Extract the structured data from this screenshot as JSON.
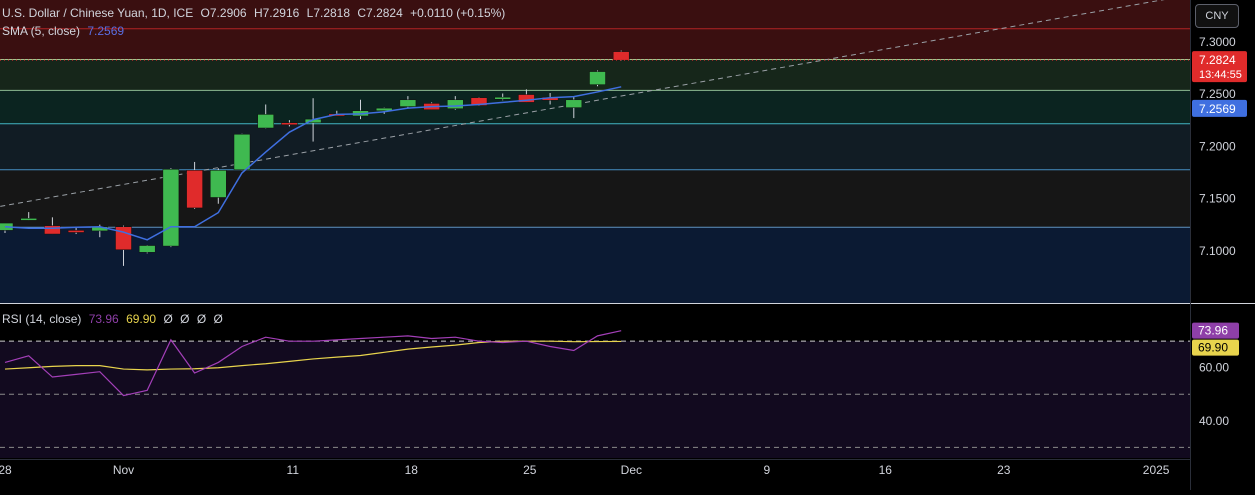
{
  "header": {
    "symbol": "U.S. Dollar / Chinese Yuan, 1D, ICE",
    "open": "O7.2906",
    "high": "H7.2916",
    "low": "L7.2818",
    "close": "C7.2824",
    "change": "+0.0110 (+0.15%)",
    "sma_label": "SMA (5, close)",
    "sma_value": "7.2569",
    "rsi_label": "RSI (14, close)",
    "rsi_value": "73.96",
    "rsi_ma_value": "69.90",
    "rsi_extra": [
      "Ø",
      "Ø",
      "Ø",
      "Ø"
    ]
  },
  "currency_button": "CNY",
  "colors": {
    "up": "#3fb950",
    "down": "#e02b2b",
    "sma": "#3f6fe0",
    "rsi": "#a33fb8",
    "rsi_ma": "#e8d44d",
    "price_tag": "#e02b2b",
    "sma_tag": "#3f6fe0"
  },
  "chart_data": [
    {
      "type": "candlestick",
      "title": "",
      "x_ticks": [
        "28",
        "Nov",
        "11",
        "18",
        "25",
        "Dec",
        "9",
        "16",
        "23",
        "2025"
      ],
      "y_ticks": [
        "7.3000",
        "7.2500",
        "7.2000",
        "7.1500",
        "7.1000"
      ],
      "ylim": [
        7.05,
        7.34
      ],
      "price_label": "7.2824",
      "countdown_label": "13:44:55",
      "sma_label": "7.2569",
      "bands": [
        {
          "from": 7.283,
          "to": 7.34,
          "color": "#3a0f10"
        },
        {
          "from": 7.2535,
          "to": 7.283,
          "color": "#16261a"
        },
        {
          "from": 7.2215,
          "to": 7.2535,
          "color": "#0b2420"
        },
        {
          "from": 7.1775,
          "to": 7.2215,
          "color": "#111c24"
        },
        {
          "from": 7.1225,
          "to": 7.1775,
          "color": "#161616"
        },
        {
          "from": 7.05,
          "to": 7.1225,
          "color": "#0b1a33"
        }
      ],
      "band_lines": [
        {
          "value": 7.3125,
          "color": "#c62828"
        },
        {
          "value": 7.283,
          "color": "#b6e3a3"
        },
        {
          "value": 7.2535,
          "color": "#a5d6a7"
        },
        {
          "value": 7.2215,
          "color": "#4dd0e1"
        },
        {
          "value": 7.1775,
          "color": "#4fa3e0"
        },
        {
          "value": 7.1225,
          "color": "#6fa8dc"
        }
      ],
      "candles": [
        {
          "o": 7.1195,
          "h": 7.1235,
          "l": 7.117,
          "c": 7.1265
        },
        {
          "o": 7.131,
          "h": 7.137,
          "l": 7.129,
          "c": 7.131
        },
        {
          "o": 7.124,
          "h": 7.132,
          "l": 7.116,
          "c": 7.116
        },
        {
          "o": 7.1195,
          "h": 7.122,
          "l": 7.116,
          "c": 7.1175
        },
        {
          "o": 7.119,
          "h": 7.125,
          "l": 7.113,
          "c": 7.123
        },
        {
          "o": 7.123,
          "h": 7.124,
          "l": 7.0855,
          "c": 7.101
        },
        {
          "o": 7.0985,
          "h": 7.1055,
          "l": 7.0975,
          "c": 7.105
        },
        {
          "o": 7.1045,
          "h": 7.179,
          "l": 7.1035,
          "c": 7.178
        },
        {
          "o": 7.177,
          "h": 7.185,
          "l": 7.14,
          "c": 7.141
        },
        {
          "o": 7.151,
          "h": 7.179,
          "l": 7.145,
          "c": 7.177
        },
        {
          "o": 7.1775,
          "h": 7.212,
          "l": 7.177,
          "c": 7.2115
        },
        {
          "o": 7.2175,
          "h": 7.24,
          "l": 7.217,
          "c": 7.2305
        },
        {
          "o": 7.2225,
          "h": 7.225,
          "l": 7.219,
          "c": 7.2215
        },
        {
          "o": 7.2225,
          "h": 7.246,
          "l": 7.2045,
          "c": 7.226
        },
        {
          "o": 7.231,
          "h": 7.234,
          "l": 7.229,
          "c": 7.229
        },
        {
          "o": 7.229,
          "h": 7.2445,
          "l": 7.226,
          "c": 7.234
        },
        {
          "o": 7.234,
          "h": 7.237,
          "l": 7.231,
          "c": 7.2365
        },
        {
          "o": 7.238,
          "h": 7.248,
          "l": 7.237,
          "c": 7.2445
        },
        {
          "o": 7.241,
          "h": 7.242,
          "l": 7.235,
          "c": 7.235
        },
        {
          "o": 7.236,
          "h": 7.248,
          "l": 7.235,
          "c": 7.2445
        },
        {
          "o": 7.2465,
          "h": 7.247,
          "l": 7.2385,
          "c": 7.239
        },
        {
          "o": 7.245,
          "h": 7.2505,
          "l": 7.244,
          "c": 7.247
        },
        {
          "o": 7.2495,
          "h": 7.2545,
          "l": 7.242,
          "c": 7.242
        },
        {
          "o": 7.247,
          "h": 7.251,
          "l": 7.24,
          "c": 7.244
        },
        {
          "o": 7.237,
          "h": 7.247,
          "l": 7.227,
          "c": 7.2445
        },
        {
          "o": 7.259,
          "h": 7.2725,
          "l": 7.2575,
          "c": 7.2715
        },
        {
          "o": 7.2906,
          "h": 7.2916,
          "l": 7.2818,
          "c": 7.2824
        }
      ],
      "sma": [
        7.123,
        7.1215,
        7.1215,
        7.1225,
        7.123,
        7.1178,
        7.1105,
        7.123,
        7.123,
        7.1365,
        7.1745,
        7.1945,
        7.2135,
        7.2255,
        7.2305,
        7.231,
        7.233,
        7.2365,
        7.238,
        7.2385,
        7.24,
        7.242,
        7.244,
        7.2465,
        7.2475,
        7.252,
        7.2569
      ],
      "trendline": {
        "start": {
          "i": -0.2,
          "v": 7.1425
        },
        "slope_per_day": 0.00403
      }
    },
    {
      "type": "line",
      "title": "",
      "ylim": [
        26,
        84
      ],
      "y_ticks": [
        "60.00",
        "40.00"
      ],
      "levels": [
        70,
        50,
        30
      ],
      "rsi_label": "73.96",
      "rsi_ma_label": "69.90",
      "series": [
        {
          "values": [
            62,
            64.5,
            56.5,
            57.5,
            58.5,
            49.5,
            51.5,
            70.5,
            58,
            62,
            68,
            71.5,
            70,
            70,
            70.5,
            71,
            71.5,
            72,
            71,
            71.5,
            70,
            69.5,
            70,
            68,
            66.5,
            72,
            73.96
          ]
        },
        {
          "values": [
            59.5,
            60,
            60.5,
            60.8,
            60.8,
            59.5,
            59.2,
            59.5,
            59.6,
            60,
            60.8,
            61.5,
            62.4,
            63.3,
            64,
            64.6,
            65.8,
            67,
            67.8,
            68.5,
            69.5,
            70,
            70,
            70,
            69.8,
            69.85,
            69.9
          ]
        }
      ]
    }
  ]
}
